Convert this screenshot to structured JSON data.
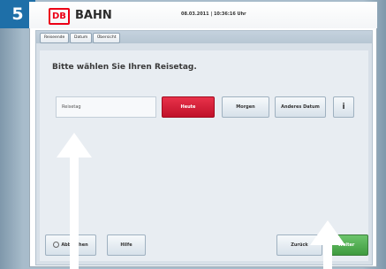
{
  "step_number": "5",
  "header": {
    "logo_text": "DB",
    "brand": "BAHN",
    "datetime": "08.03.2011 | 10:36:16 Uhr"
  },
  "tabs": [
    {
      "label": "Reiseende"
    },
    {
      "label": "Datum"
    },
    {
      "label": "Übersicht"
    }
  ],
  "main": {
    "title": "Bitte wählen Sie Ihren Reisetag.",
    "field_label": "Reisetag",
    "buttons": {
      "today": "Heute",
      "tomorrow": "Morgen",
      "other_date": "Anderes Datum",
      "info": "i"
    }
  },
  "footer": {
    "cancel": "Abbrechen",
    "help": "Hilfe",
    "back": "Zurück",
    "next": "Weiter"
  },
  "colors": {
    "db_red": "#ec0016",
    "accent_green": "#4caf50",
    "step_blue": "#1e6fa8"
  }
}
